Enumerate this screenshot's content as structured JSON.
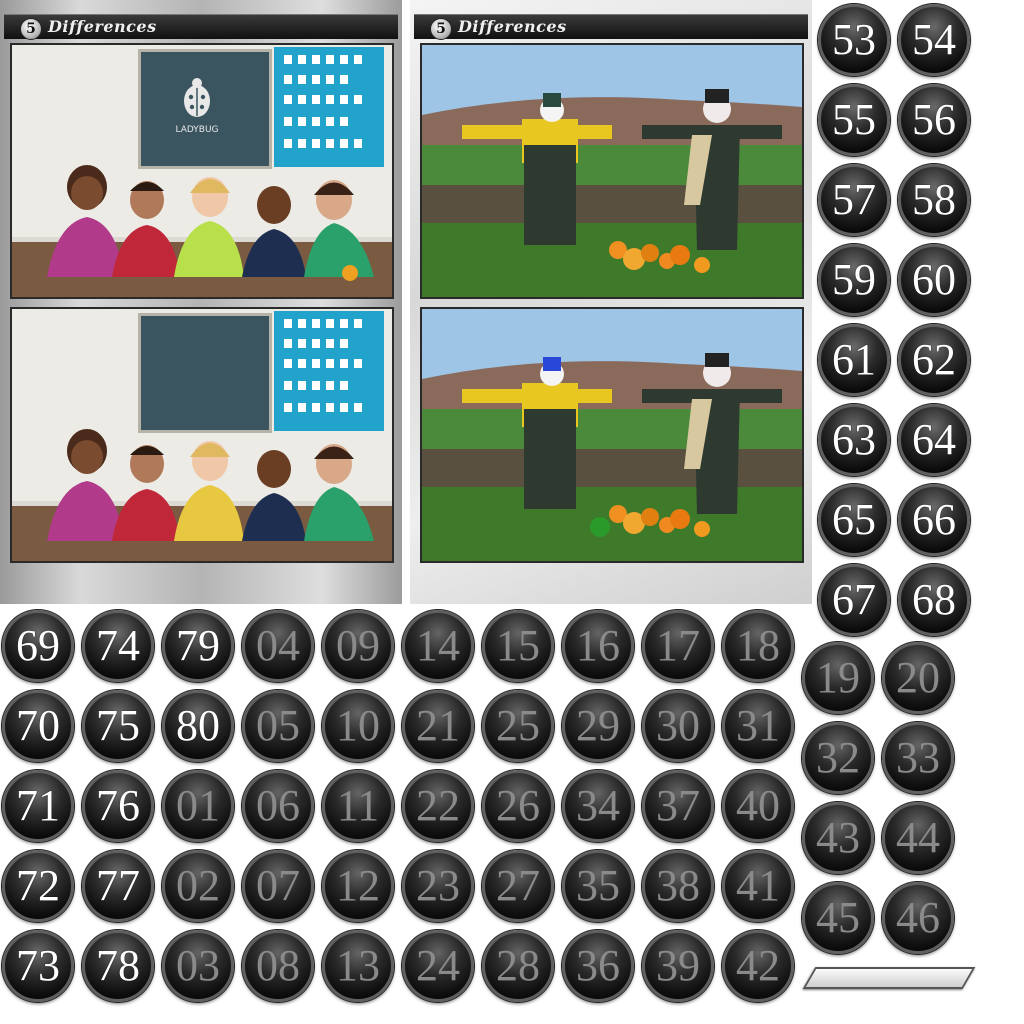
{
  "panels": [
    {
      "level": "5",
      "title": "Differences"
    },
    {
      "level": "5",
      "title": "Differences"
    }
  ],
  "photos": {
    "kids_top": {
      "poster_text": "LADYBUG",
      "description": "five children lying on floor, chalkboard and cards behind, orange ball on floor"
    },
    "kids_bottom": {
      "description": "same scene, differences: ladybug missing, ball missing"
    },
    "scarecrow_top": {
      "description": "two scarecrows with pumpkins in a field"
    },
    "scarecrow_bottom": {
      "description": "same scene, differences: blue hat, green ball"
    }
  },
  "right_balls": {
    "bright": [
      "53",
      "54",
      "55",
      "56",
      "57",
      "58",
      "59",
      "60",
      "61",
      "62",
      "63",
      "64",
      "65",
      "66",
      "67",
      "68"
    ],
    "dim": [
      "19",
      "20",
      "32",
      "33",
      "43",
      "44",
      "45",
      "46"
    ]
  },
  "bottom_grid": [
    [
      "69",
      "74",
      "79",
      "04",
      "09",
      "14",
      "15",
      "16",
      "17",
      "18"
    ],
    [
      "70",
      "75",
      "80",
      "05",
      "10",
      "21",
      "25",
      "29",
      "30",
      "31"
    ],
    [
      "71",
      "76",
      "01",
      "06",
      "11",
      "22",
      "26",
      "34",
      "37",
      "40"
    ],
    [
      "72",
      "77",
      "02",
      "07",
      "12",
      "23",
      "27",
      "35",
      "38",
      "41"
    ],
    [
      "73",
      "78",
      "03",
      "08",
      "13",
      "24",
      "28",
      "36",
      "39",
      "42"
    ]
  ],
  "bright_columns_in_grid": 3,
  "bright_cells": [
    "69",
    "74",
    "79",
    "70",
    "75",
    "80",
    "71",
    "76",
    "72",
    "77",
    "73",
    "78"
  ],
  "colors": {
    "ball_dark": "#0c0c0c",
    "ball_text": "#ffffff",
    "ball_text_dim": "#8a8a8a",
    "header": "#111111"
  }
}
